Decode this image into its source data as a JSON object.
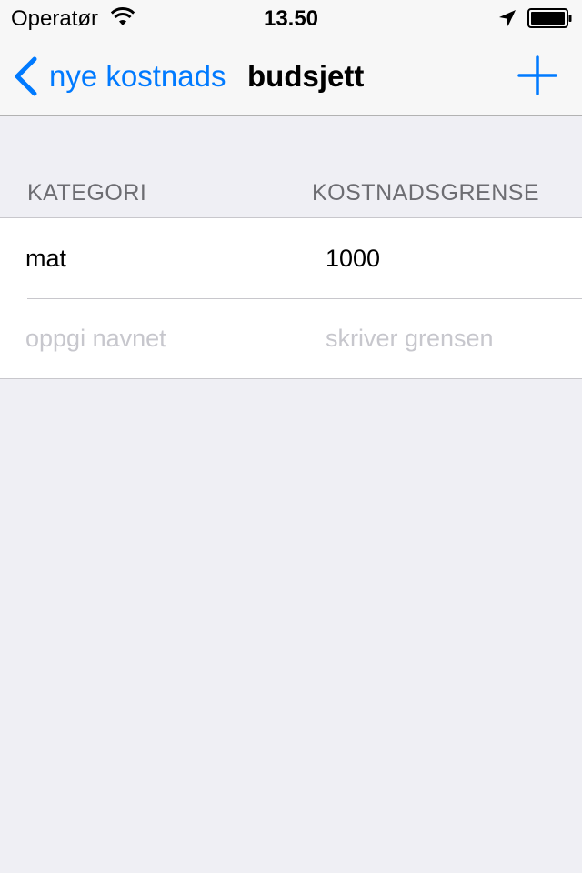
{
  "status_bar": {
    "carrier": "Operatør",
    "time": "13.50",
    "icons": [
      "wifi-icon",
      "location-arrow-icon",
      "battery-icon"
    ]
  },
  "nav_bar": {
    "back_label": "nye kostnads",
    "title": "budsjett",
    "back_icon": "chevron-left-icon",
    "add_icon": "plus-icon",
    "accent_color": "#007aff"
  },
  "table": {
    "headers": {
      "category": "KATEGORI",
      "limit": "KOSTNADSGRENSE"
    },
    "rows": [
      {
        "category": "mat",
        "limit": "1000"
      }
    ],
    "new_row": {
      "category_placeholder": "oppgi navnet",
      "limit_placeholder": "skriver grensen"
    }
  }
}
